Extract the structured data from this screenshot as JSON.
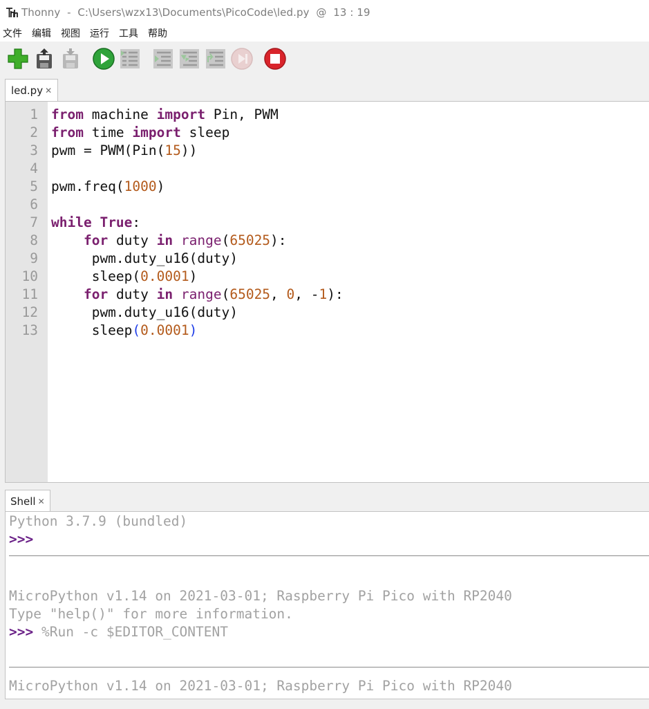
{
  "window": {
    "app_name": "Thonny",
    "dash": "-",
    "file_path": "C:\\Users\\wzx13\\Documents\\PicoCode\\led.py",
    "at": "@",
    "cursor_position": "13 : 19"
  },
  "menu": [
    "文件",
    "编辑",
    "视图",
    "运行",
    "工具",
    "帮助"
  ],
  "toolbar": {
    "icons": [
      "new-file-icon",
      "open-file-icon",
      "save-file-icon",
      "run-icon",
      "debug-icon",
      "step-over-icon",
      "step-into-icon",
      "step-out-icon",
      "resume-icon",
      "stop-icon"
    ],
    "colors": {
      "new": "#3fae2a",
      "run": "#2fa33a",
      "stop": "#d9242b"
    }
  },
  "editor": {
    "tab_label": "led.py",
    "close_glyph": "✕",
    "line_numbers": [
      "1",
      "2",
      "3",
      "4",
      "5",
      "6",
      "7",
      "8",
      "9",
      "10",
      "11",
      "12",
      "13"
    ]
  },
  "code": {
    "l1": {
      "a": "from",
      "b": " machine ",
      "c": "import",
      "d": " Pin, PWM"
    },
    "l2": {
      "a": "from",
      "b": " time ",
      "c": "import",
      "d": " sleep"
    },
    "l3": {
      "a": "pwm = PWM(Pin(",
      "n": "15",
      "z": "))"
    },
    "l5": {
      "a": "pwm.freq(",
      "n": "1000",
      "z": ")"
    },
    "l7": {
      "a": "while",
      "b": " ",
      "c": "True",
      "z": ":"
    },
    "l8": {
      "i": "    ",
      "a": "for",
      "b": " duty ",
      "c": "in",
      "d": " ",
      "e": "range",
      "f": "(",
      "n": "65025",
      "z": "):"
    },
    "l9": {
      "t": "     pwm.duty_u16(duty)"
    },
    "l10": {
      "a": "     sleep(",
      "n": "0.0001",
      "z": ")"
    },
    "l11": {
      "i": "    ",
      "a": "for",
      "b": " duty ",
      "c": "in",
      "d": " ",
      "e": "range",
      "f": "(",
      "n1": "65025",
      "s1": ", ",
      "n2": "0",
      "s2": ", -",
      "n3": "1",
      "z": "):"
    },
    "l12": {
      "t": "     pwm.duty_u16(duty)"
    },
    "l13": {
      "a": "     sleep",
      "p1": "(",
      "n": "0.0001",
      "p2": ")"
    }
  },
  "shell": {
    "tab_label": "Shell",
    "close_glyph": "✕",
    "lines": {
      "python_version": "Python 3.7.9 (bundled)",
      "prompt": ">>>",
      "banner": "MicroPython v1.14 on 2021-03-01; Raspberry Pi Pico with RP2040",
      "help_hint": "Type \"help()\" for more information.",
      "run_command": " %Run -c $EDITOR_CONTENT",
      "banner2": "MicroPython v1.14 on 2021-03-01; Raspberry Pi Pico with RP2040"
    }
  }
}
